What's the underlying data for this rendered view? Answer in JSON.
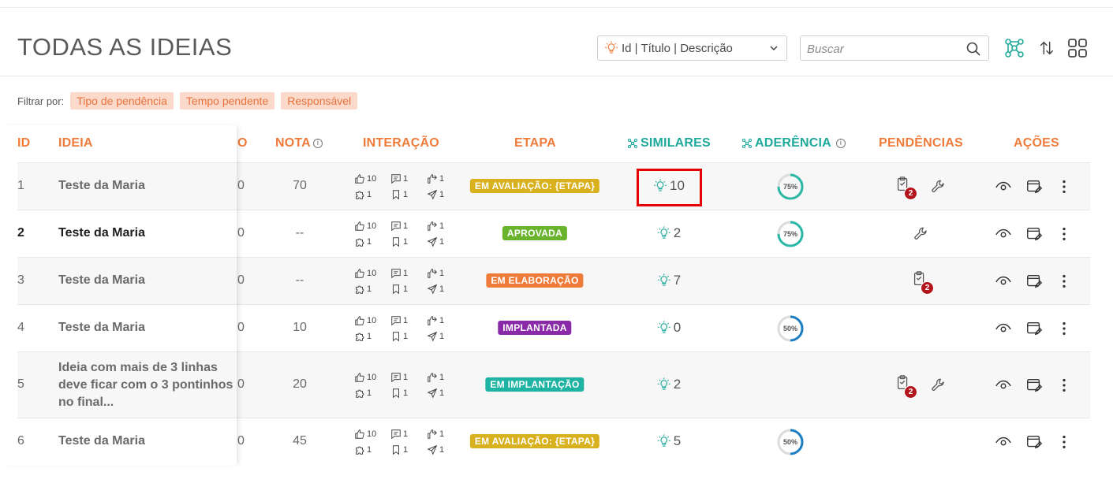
{
  "page": {
    "title": "TODAS AS IDEIAS"
  },
  "search_field_select": {
    "selected": "Id | Título | Descrição",
    "icon": "lightbulb-icon"
  },
  "search": {
    "placeholder": "Buscar",
    "value": ""
  },
  "header_icons": [
    "network-graph-icon",
    "sort-icon",
    "grid-view-icon"
  ],
  "filters": {
    "label": "Filtrar por:",
    "chips": [
      "Tipo de pendência",
      "Tempo pendente",
      "Responsável"
    ]
  },
  "columns": {
    "id": "ID",
    "idea": "IDEIA",
    "clipped": "O",
    "grade": "NOTA",
    "interaction": "INTERAÇÃO",
    "stage": "ETAPA",
    "similar": "SIMILARES",
    "adherence": "ADERÊNCIA",
    "pending": "PENDÊNCIAS",
    "actions": "AÇÕES"
  },
  "colors": {
    "accent_orange": "#ef7b3a",
    "accent_teal": "#1fa99a",
    "stage_evaluation": "#d9b11e",
    "stage_approved": "#6ab32d",
    "stage_elaboration": "#ef7b3a",
    "stage_implanted": "#8a2aa8",
    "stage_implementation": "#1fb3a3",
    "ring_75": "#2bb8a6",
    "ring_50": "#1d7fc4",
    "pending_badge": "#b3151c",
    "highlight": "#e60000"
  },
  "rows": [
    {
      "id": "1",
      "idea": "Teste da Maria",
      "clipped": "0",
      "grade": "70",
      "likes": "10",
      "comments": "1",
      "shares": "1",
      "puzzles": "1",
      "saves": "1",
      "sends": "1",
      "stage": "EM AVALIAÇÃO: {ETAPA}",
      "stage_color": "#d9b11e",
      "similar": "10",
      "adherence": "75%",
      "adherence_value": 75,
      "pending_tasks": "2",
      "pending_tool": true,
      "highlighted": true
    },
    {
      "id": "2",
      "idea": "Teste da Maria",
      "clipped": "0",
      "grade": "--",
      "likes": "10",
      "comments": "1",
      "shares": "1",
      "puzzles": "1",
      "saves": "1",
      "sends": "1",
      "stage": "APROVADA",
      "stage_color": "#6ab32d",
      "similar": "2",
      "adherence": "75%",
      "adherence_value": 75,
      "pending_tasks": "",
      "pending_tool": true,
      "bold": true
    },
    {
      "id": "3",
      "idea": "Teste da Maria",
      "clipped": "0",
      "grade": "--",
      "likes": "10",
      "comments": "1",
      "shares": "1",
      "puzzles": "1",
      "saves": "1",
      "sends": "1",
      "stage": "EM ELABORAÇÃO",
      "stage_color": "#ef7b3a",
      "similar": "7",
      "adherence": "",
      "adherence_value": null,
      "pending_tasks": "2",
      "pending_tool": false
    },
    {
      "id": "4",
      "idea": "Teste da Maria",
      "clipped": "0",
      "grade": "10",
      "likes": "10",
      "comments": "1",
      "shares": "1",
      "puzzles": "1",
      "saves": "1",
      "sends": "1",
      "stage": "IMPLANTADA",
      "stage_color": "#8a2aa8",
      "similar": "0",
      "adherence": "50%",
      "adherence_value": 50,
      "pending_tasks": "",
      "pending_tool": false
    },
    {
      "id": "5",
      "idea": "Ideia com mais de 3 linhas deve ficar com o 3 pontinhos no final...",
      "idea_lines": [
        "Ideia com mais de 3 linhas",
        "deve ficar com o 3 pontinhos",
        "no final..."
      ],
      "clipped": "0",
      "grade": "20",
      "likes": "10",
      "comments": "1",
      "shares": "1",
      "puzzles": "1",
      "saves": "1",
      "sends": "1",
      "stage": "EM IMPLANTAÇÃO",
      "stage_color": "#1fb3a3",
      "similar": "2",
      "adherence": "",
      "adherence_value": null,
      "pending_tasks": "2",
      "pending_tool": true
    },
    {
      "id": "6",
      "idea": "Teste da Maria",
      "clipped": "0",
      "grade": "45",
      "likes": "10",
      "comments": "1",
      "shares": "1",
      "puzzles": "1",
      "saves": "1",
      "sends": "1",
      "stage": "EM AVALIAÇÃO: {ETAPA}",
      "stage_color": "#d9b11e",
      "similar": "5",
      "adherence": "50%",
      "adherence_value": 50,
      "pending_tasks": "",
      "pending_tool": false
    }
  ]
}
